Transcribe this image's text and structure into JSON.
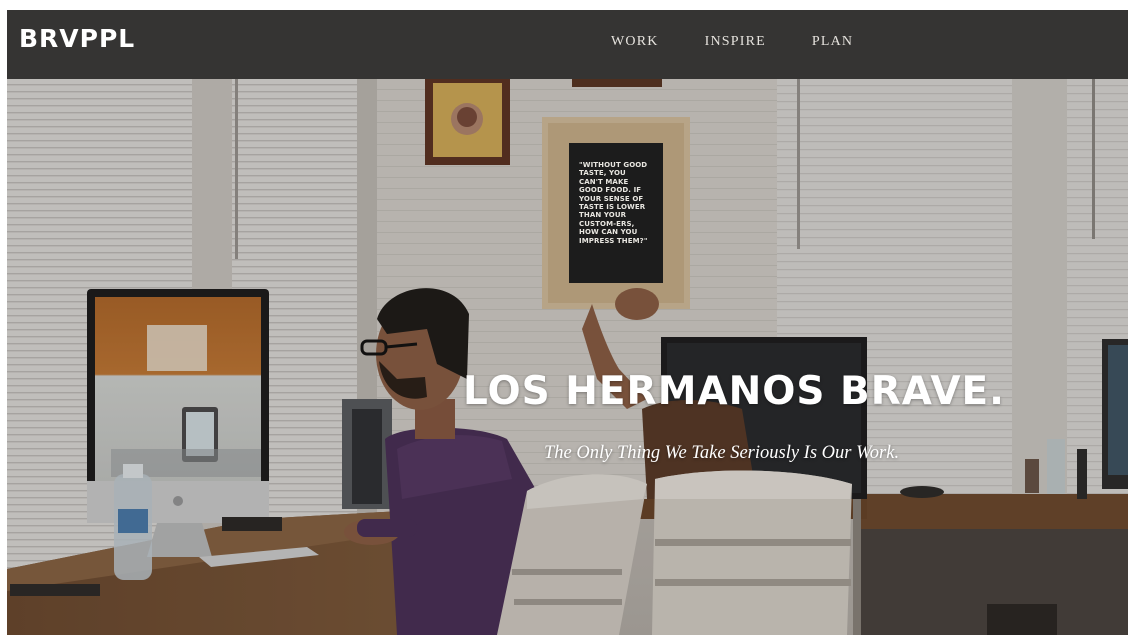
{
  "brand": {
    "logo_text": "BRVPPL"
  },
  "nav": {
    "items": [
      {
        "label": "WORK"
      },
      {
        "label": "INSPIRE"
      },
      {
        "label": "PLAN"
      }
    ]
  },
  "hero": {
    "title": "LOS HERMANOS BRAVE.",
    "subtitle": "The Only Thing We Take Seriously Is Our Work.",
    "poster_quote": "\"WITHOUT GOOD TASTE, YOU CAN'T MAKE GOOD FOOD. IF YOUR SENSE OF TASTE IS LOWER THAN YOUR CUSTOM-ERS, HOW CAN YOU IMPRESS THEM?\""
  },
  "colors": {
    "topbar": "#353433",
    "nav_text": "#e6e3de",
    "hero_text": "#ffffff"
  }
}
